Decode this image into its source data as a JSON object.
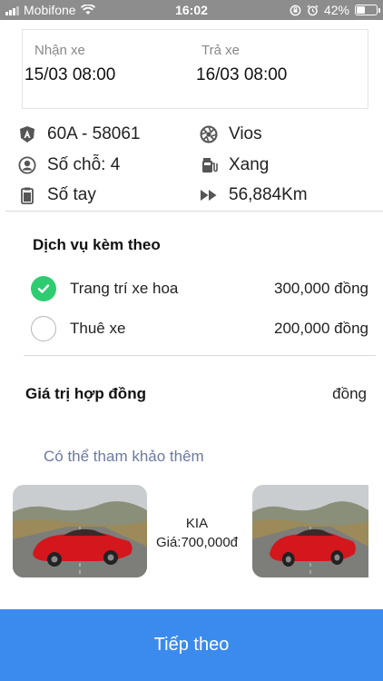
{
  "status_bar": {
    "carrier": "Mobifone",
    "time": "16:02",
    "battery_text": "42%",
    "battery_level": 0.42
  },
  "dates": {
    "pickup_label": "Nhận xe",
    "pickup_value": "15/03 08:00",
    "return_label": "Trả xe",
    "return_value": "16/03 08:00"
  },
  "specs": {
    "plate": "60A - 58061",
    "model": "Vios",
    "seats": "Số chỗ: 4",
    "fuel": "Xang",
    "transmission": "Số tay",
    "mileage": "56,884Km"
  },
  "services": {
    "title": "Dịch vụ kèm theo",
    "items": [
      {
        "name": "Trang trí xe hoa",
        "price": "300,000 đồng",
        "selected": true
      },
      {
        "name": "Thuê xe",
        "price": "200,000 đồng",
        "selected": false
      }
    ]
  },
  "contract": {
    "label": "Giá trị hợp đồng",
    "value": "đồng"
  },
  "suggestions": {
    "title": "Có thể tham khảo thêm",
    "car_brand": "KIA",
    "car_price": "Giá:700,000đ"
  },
  "footer": {
    "next_label": "Tiếp theo"
  },
  "colors": {
    "accent": "#3b8bef",
    "check_green": "#2ecc71",
    "status_bar": "#8d8d8d"
  }
}
